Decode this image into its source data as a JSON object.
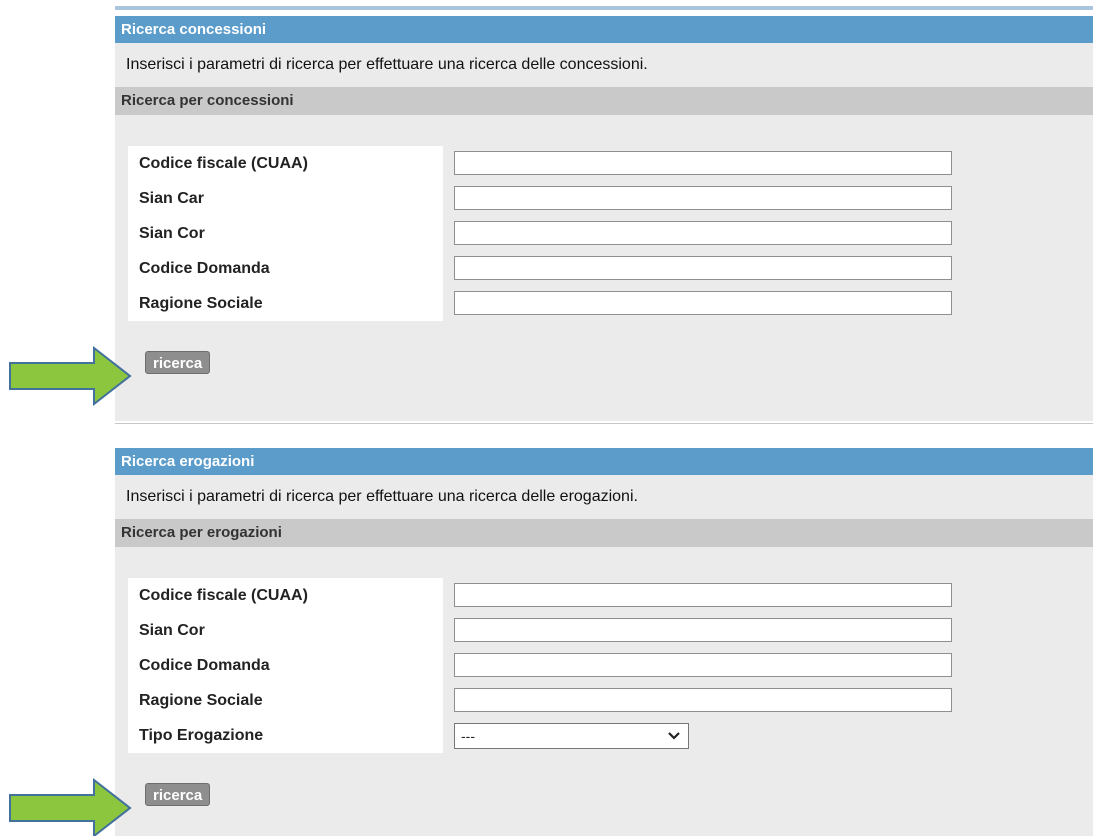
{
  "concessioni": {
    "header": "Ricerca concessioni",
    "intro": "Inserisci i parametri di ricerca per effettuare una ricerca delle concessioni.",
    "subheader": "Ricerca per concessioni",
    "fields": [
      {
        "label": "Codice fiscale (CUAA)",
        "value": ""
      },
      {
        "label": "Sian Car",
        "value": ""
      },
      {
        "label": "Sian Cor",
        "value": ""
      },
      {
        "label": "Codice Domanda",
        "value": ""
      },
      {
        "label": "Ragione Sociale",
        "value": ""
      }
    ],
    "search_button": "ricerca"
  },
  "erogazioni": {
    "header": "Ricerca erogazioni",
    "intro": "Inserisci i parametri di ricerca per effettuare una ricerca delle erogazioni.",
    "subheader": "Ricerca per erogazioni",
    "fields": [
      {
        "label": "Codice fiscale (CUAA)",
        "value": ""
      },
      {
        "label": "Sian Cor",
        "value": ""
      },
      {
        "label": "Codice Domanda",
        "value": ""
      },
      {
        "label": "Ragione Sociale",
        "value": ""
      }
    ],
    "tipo_erogazione": {
      "label": "Tipo Erogazione",
      "selected": "---"
    },
    "search_button": "ricerca"
  },
  "colors": {
    "section_header": "#5b9ccb",
    "panel_bg": "#ebebeb",
    "subheader_bg": "#c9c9c9",
    "button_bg": "#8e8e8e",
    "arrow_fill": "#8cc63f",
    "arrow_stroke": "#41719c"
  }
}
